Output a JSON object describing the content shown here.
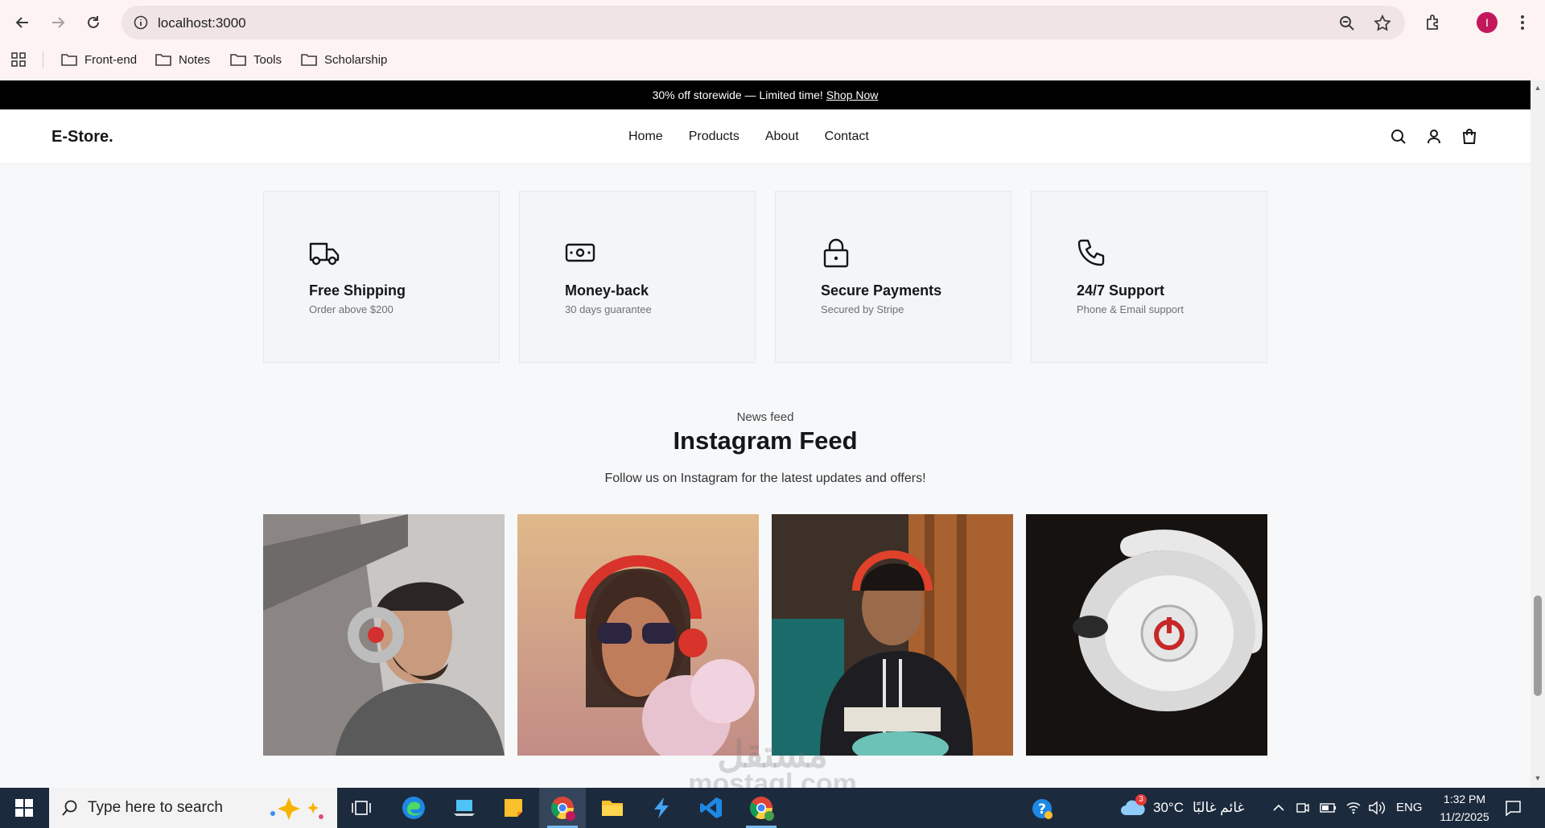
{
  "browser": {
    "url": "localhost:3000",
    "profile_initial": "I",
    "bookmarks": [
      "Front-end",
      "Notes",
      "Tools",
      "Scholarship"
    ]
  },
  "promo": {
    "text": "30% off storewide — Limited time!",
    "link": "Shop Now"
  },
  "header": {
    "logo": "E-Store.",
    "nav": [
      "Home",
      "Products",
      "About",
      "Contact"
    ]
  },
  "features": [
    {
      "title": "Free Shipping",
      "subtitle": "Order above $200",
      "icon": "truck-icon"
    },
    {
      "title": "Money-back",
      "subtitle": "30 days guarantee",
      "icon": "money-icon"
    },
    {
      "title": "Secure Payments",
      "subtitle": "Secured by Stripe",
      "icon": "lock-icon"
    },
    {
      "title": "24/7 Support",
      "subtitle": "Phone & Email support",
      "icon": "phone-icon"
    }
  ],
  "feed": {
    "eyebrow": "News feed",
    "title": "Instagram Feed",
    "subtitle": "Follow us on Instagram for the latest updates and offers!"
  },
  "taskbar": {
    "search_placeholder": "Type here to search",
    "weather_temp": "30°C",
    "weather_text": "غائم غالبًا",
    "weather_badge": "3",
    "language": "ENG",
    "time": "1:32 PM",
    "date": "11/2/2025"
  },
  "watermark": {
    "top": "مستقل",
    "bottom": "mostaql.com"
  }
}
